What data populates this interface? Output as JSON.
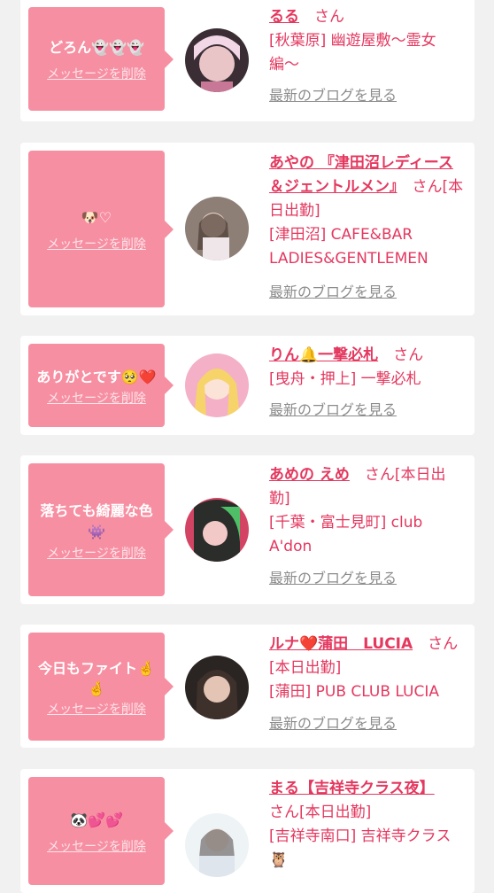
{
  "cards": [
    {
      "message": "どろん👻👻👻",
      "delete_label": "メッセージを削除",
      "name": "るる",
      "honorific": "さん",
      "shop": "[秋葉原] 幽遊屋敷〜霊女編〜",
      "blog_label": "最新のブログを見る"
    },
    {
      "message": "🐶♡",
      "delete_label": "メッセージを削除",
      "name": "あやの 『津田沼レディース＆ジェントルメン』",
      "honorific": "さん[本日出勤]",
      "shop": "[津田沼] CAFE&BAR LADIES&GENTLEMEN",
      "blog_label": "最新のブログを見る"
    },
    {
      "message_text": "ありがとです",
      "message_emoji": "🥺❤️",
      "delete_label": "メッセージを削除",
      "name_a": "りん",
      "name_icon": "🔔",
      "name_b": "一撃必札",
      "honorific": "さん",
      "shop": "[曳舟・押上] 一撃必札",
      "blog_label": "最新のブログを見る"
    },
    {
      "message_text": "落ちても綺麗な色",
      "message_emoji": "👾",
      "delete_label": "メッセージを削除",
      "name": "あめの えめ",
      "honorific": "さん[本日出勤]",
      "shop": "[千葉・富士見町] club A'don",
      "blog_label": "最新のブログを見る"
    },
    {
      "message_text": "今日もファイト",
      "message_emoji_1": "🤞",
      "message_emoji_2": "🤞",
      "delete_label": "メッセージを削除",
      "name_a": "ルナ",
      "name_icon": "❤️",
      "name_b": "蒲田　LUCIA",
      "honorific": "さん[本日出勤]",
      "shop": "[蒲田] PUB CLUB LUCIA",
      "blog_label": "最新のブログを見る"
    },
    {
      "message": "🐼💕💕",
      "delete_label": "メッセージを削除",
      "name": "まる【吉祥寺クラス夜】",
      "honorific": "さん[本日出勤]",
      "shop": "[吉祥寺南口] 吉祥寺クラス🦉",
      "blog_label": ""
    }
  ]
}
